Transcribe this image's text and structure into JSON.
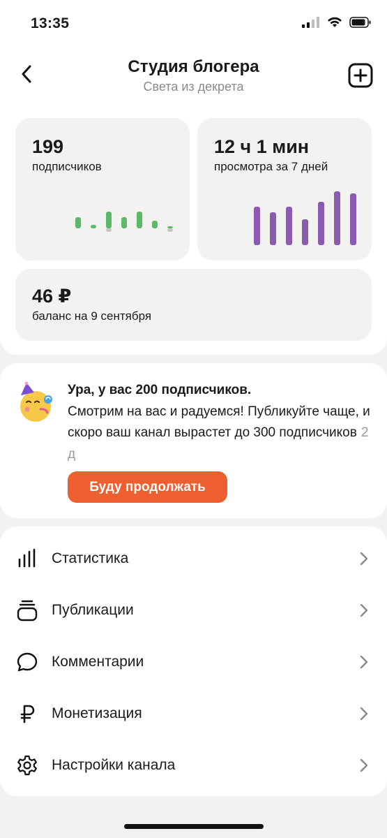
{
  "status_bar": {
    "time": "13:35"
  },
  "header": {
    "title": "Студия блогера",
    "subtitle": "Света из декрета"
  },
  "stats": {
    "subscribers": {
      "value": "199",
      "label": "подписчиков",
      "color": "#5cb96a",
      "bars": [
        {
          "up": 16,
          "down": 0
        },
        {
          "up": 5,
          "down": 0
        },
        {
          "up": 24,
          "down": 5
        },
        {
          "up": 16,
          "down": 0
        },
        {
          "up": 24,
          "down": 0
        },
        {
          "up": 11,
          "down": 0
        },
        {
          "up": 3,
          "down": 5
        }
      ]
    },
    "views": {
      "value": "12 ч 1 мин",
      "label": "просмотра за 7 дней",
      "color": "#8b5bb0",
      "bars": [
        55,
        47,
        55,
        37,
        62,
        77,
        74
      ]
    },
    "balance": {
      "value": "46 ₽",
      "label": "баланс на 9 сентября"
    }
  },
  "promo": {
    "title": "Ура, у вас 200 подписчиков.",
    "body": "Смотрим на вас и радуемся! Публикуйте чаще, и скоро ваш канал вырастет до 300 подписчиков",
    "age": "2 д",
    "button": "Буду продолжать",
    "accent": "#ed5f2f"
  },
  "menu": [
    {
      "icon": "bar-chart-icon",
      "label": "Статистика"
    },
    {
      "icon": "publications-icon",
      "label": "Публикации"
    },
    {
      "icon": "comment-icon",
      "label": "Комментарии"
    },
    {
      "icon": "ruble-icon",
      "label": "Монетизация"
    },
    {
      "icon": "gear-icon",
      "label": "Настройки канала"
    }
  ]
}
